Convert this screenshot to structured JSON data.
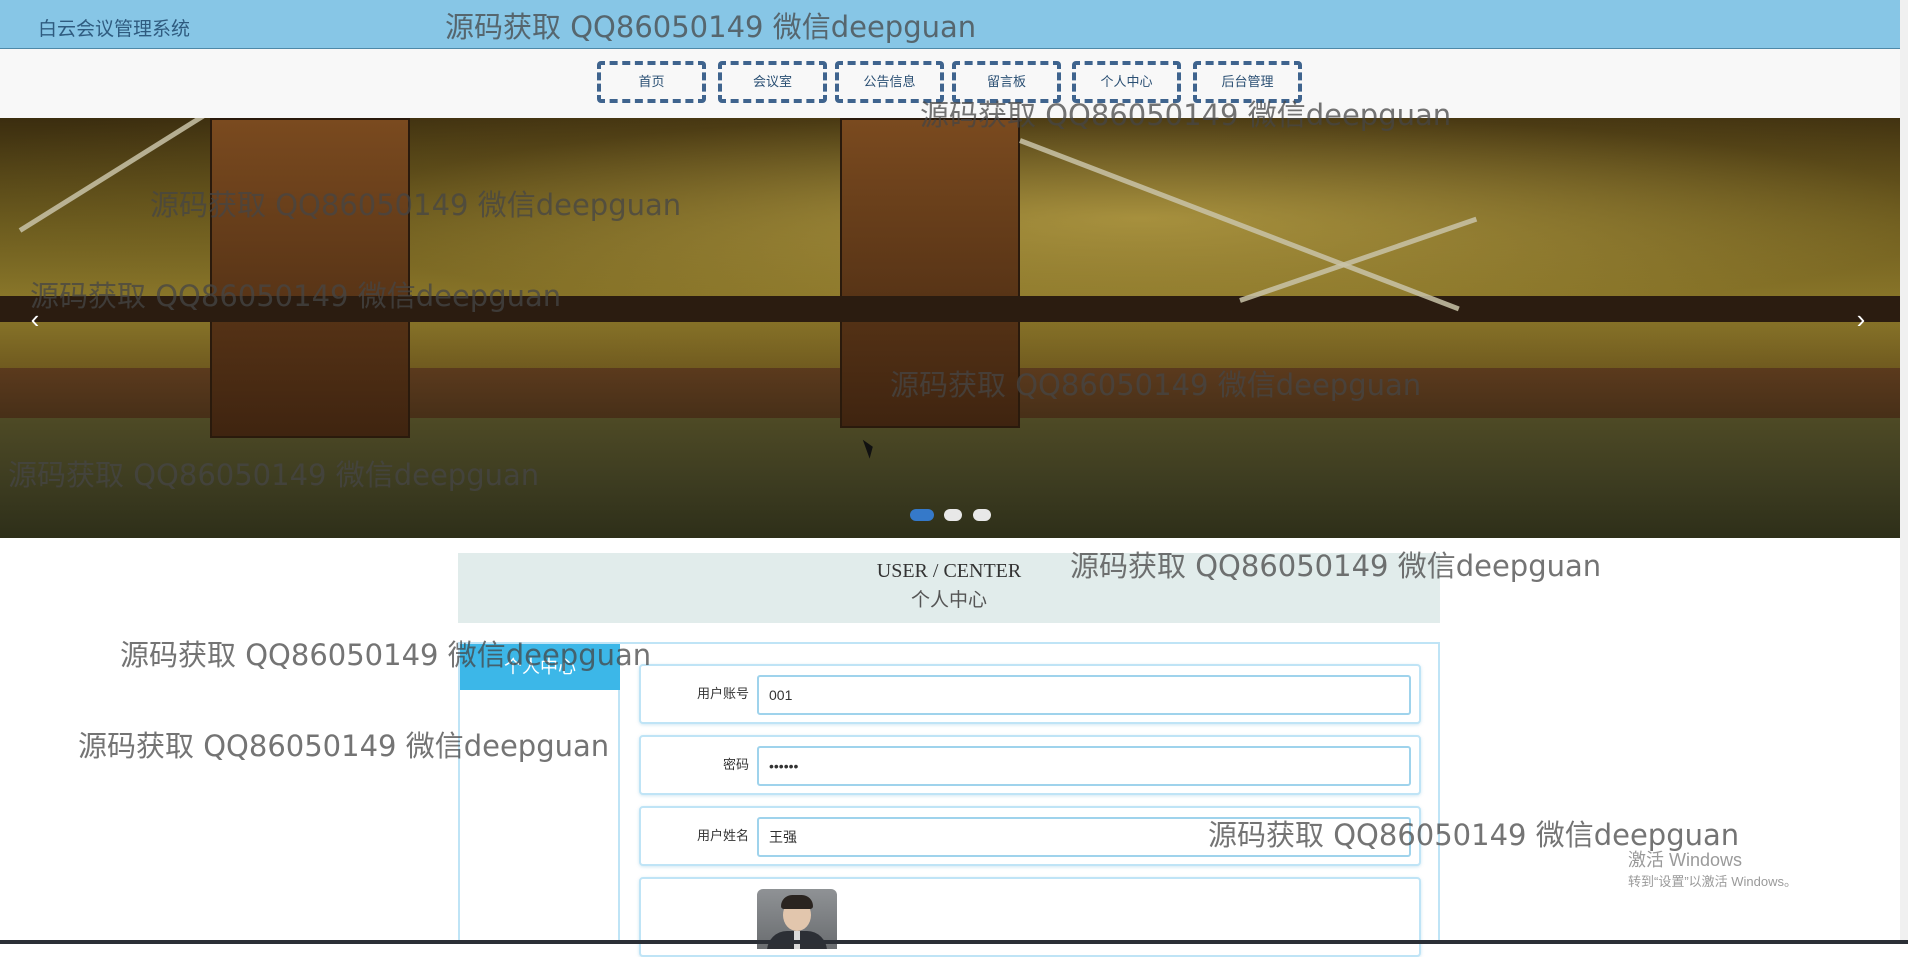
{
  "header": {
    "brand": "白云会议管理系统"
  },
  "nav": {
    "items": [
      {
        "label": "首页"
      },
      {
        "label": "会议室"
      },
      {
        "label": "公告信息"
      },
      {
        "label": "留言板"
      },
      {
        "label": "个人中心"
      },
      {
        "label": "后台管理"
      }
    ]
  },
  "banner": {
    "prev_icon": "chevron-left-icon",
    "next_icon": "chevron-right-icon",
    "prev_glyph": "‹",
    "next_glyph": "›",
    "slide_count": 3,
    "active_slide": 1
  },
  "user_center": {
    "title_en": "USER / CENTER",
    "title_cn": "个人中心",
    "sidebar_active": "个人中心",
    "fields": [
      {
        "label": "用户账号",
        "value": "001"
      },
      {
        "label": "密码",
        "value": "••••••"
      },
      {
        "label": "用户姓名",
        "value": "王强"
      }
    ]
  },
  "watermark": "源码获取 QQ86050149 微信deepguan",
  "os_notice": {
    "line1": "激活 Windows",
    "line2": "转到“设置”以激活 Windows。"
  },
  "colors": {
    "topbar": "#87c6e6",
    "nav_border": "#3f648e",
    "active_blue": "#3cb7e8",
    "panel_border": "#bfe4f6"
  }
}
